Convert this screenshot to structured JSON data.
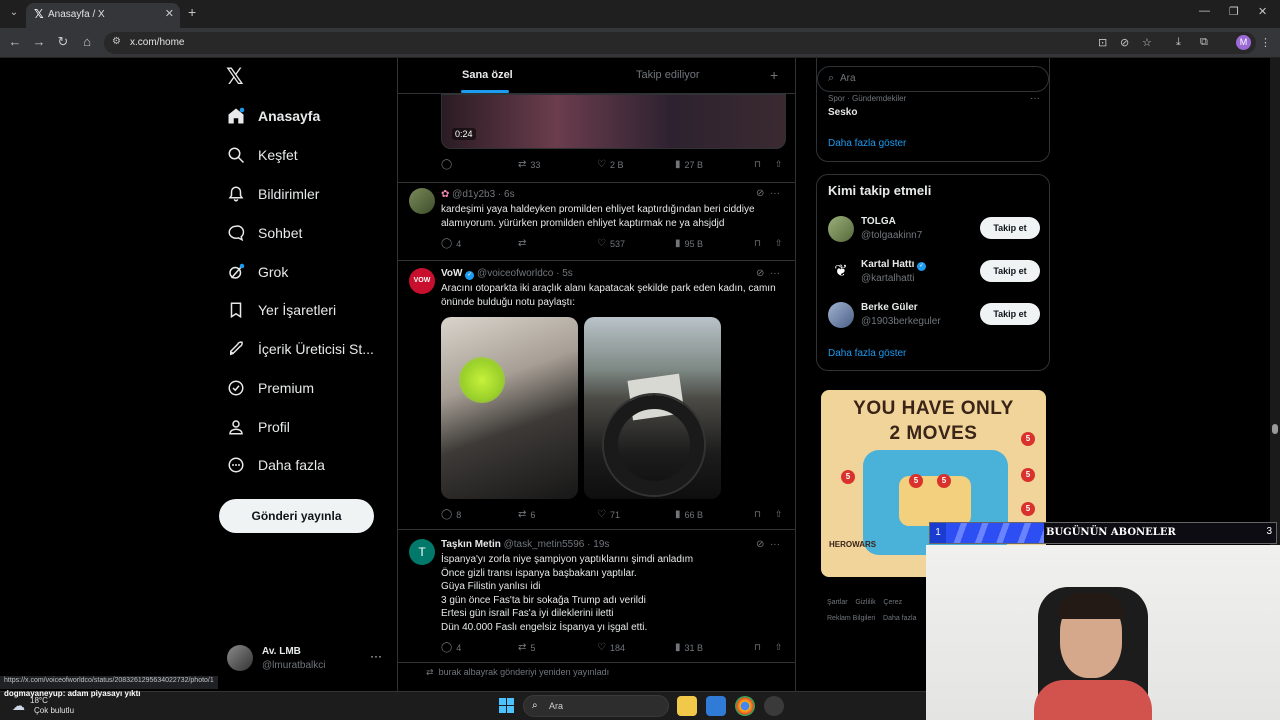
{
  "browser": {
    "tab_title": "Anasayfa / X",
    "url": "x.com/home",
    "profile_initial": "M",
    "status_url": "https://x.com/voiceofworldco/status/2083261295634022732/photo/1"
  },
  "nav": {
    "items": [
      {
        "label": "Anasayfa",
        "icon": "home-icon"
      },
      {
        "label": "Keşfet",
        "icon": "search-icon"
      },
      {
        "label": "Bildirimler",
        "icon": "bell-icon"
      },
      {
        "label": "Sohbet",
        "icon": "chat-icon"
      },
      {
        "label": "Grok",
        "icon": "grok-icon"
      },
      {
        "label": "Yer İşaretleri",
        "icon": "bookmark-icon"
      },
      {
        "label": "İçerik Üreticisi St...",
        "icon": "rocket-icon"
      },
      {
        "label": "Premium",
        "icon": "premium-icon"
      },
      {
        "label": "Profil",
        "icon": "profile-icon"
      },
      {
        "label": "Daha fazla",
        "icon": "more-circle-icon"
      }
    ],
    "post_button": "Gönderi yayınla",
    "account": {
      "name": "Av. LMB",
      "handle": "@lmuratbalkci"
    }
  },
  "timeline": {
    "tabs": [
      "Sana özel",
      "Takip ediliyor"
    ],
    "video_time": "0:24",
    "video_stats": {
      "replies": "",
      "reposts": "33",
      "likes": "2 B",
      "views": "27 B"
    },
    "posts": [
      {
        "name": "",
        "handle": "@d1y2b3",
        "time": "6s",
        "text": "kardeşimi yaya haldeyken promilden ehliyet kaptırdığından beri ciddiye alamıyorum. yürürken promilden ehliyet kaptırmak ne ya ahsjdjd",
        "replies": "4",
        "reposts": "",
        "likes": "537",
        "views": "95 B"
      },
      {
        "name": "VoW",
        "handle": "@voiceofworldco",
        "time": "5s",
        "text": "Aracını otoparkta iki araçlık alanı kapatacak şekilde park eden kadın, camın önünde bulduğu notu paylaştı:",
        "replies": "8",
        "reposts": "6",
        "likes": "71",
        "views": "66 B"
      },
      {
        "name": "Taşkın Metin",
        "handle": "@task_metin5596",
        "time": "19s",
        "lines": [
          "İspanya'yı zorla niye şampiyon yaptıklarını şimdi anladım",
          "Önce gizli transı ispanya başbakanı yaptılar.",
          "Güya Filistin yanlısı idi",
          "3 gün önce Fas'ta bir sokağa Trump adı verildi",
          "Ertesi gün israil Fas'a iyi dileklerini iletti",
          "Dün 40.000 Faslı  engelsiz İspanya yı işgal etti."
        ],
        "replies": "4",
        "reposts": "5",
        "likes": "184",
        "views": "31 B"
      }
    ],
    "repost_notice": "burak albayrak gönderiyi yeniden yayınladı"
  },
  "right": {
    "search_placeholder": "Ara",
    "trend": {
      "category": "Spor · Gündemdekiler",
      "name": "Sesko",
      "more": "Daha fazla göster"
    },
    "who_to_follow": {
      "title": "Kimi takip etmeli",
      "users": [
        {
          "name": "TOLGA",
          "handle": "@tolgaakinn7",
          "verified": false
        },
        {
          "name": "Kartal Hattı",
          "handle": "@kartalhatti",
          "verified": true
        },
        {
          "name": "Berke Güler",
          "handle": "@1903berkeguler",
          "verified": false
        }
      ],
      "follow_label": "Takip et",
      "more": "Daha fazla göster"
    },
    "ad": {
      "title_line1": "YOU HAVE ONLY",
      "title_line2": "2 MOVES",
      "logo": "HEROWARS",
      "badge": "5"
    },
    "footer": {
      "line1": [
        "Şartlar",
        "Gizlilik",
        "Çerez"
      ],
      "line2": [
        "Reklam Bilgileri",
        "Daha fazla"
      ]
    }
  },
  "stream": {
    "subs_left": "1",
    "subs_label": "BUGÜNÜN ABONELER",
    "subs_right": "3",
    "chat_user": "dogmayaneyup",
    "chat_text": ": adam piyasayı yıktı"
  },
  "taskbar": {
    "weather_temp": "18°C",
    "weather_desc": "Çok bulutlu",
    "search_placeholder": "Ara"
  }
}
